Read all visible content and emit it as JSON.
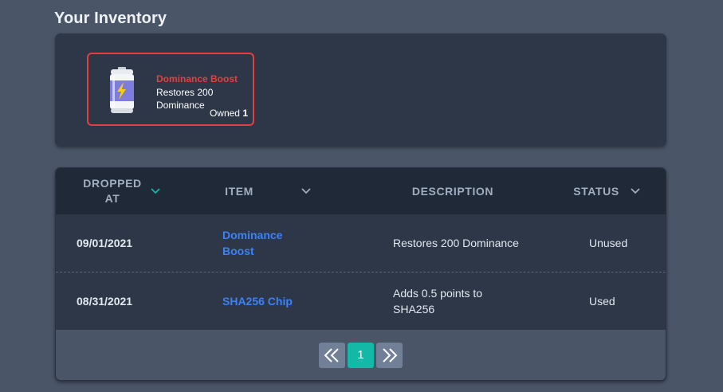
{
  "page": {
    "title": "Your Inventory"
  },
  "inventory": {
    "items": [
      {
        "name": "Dominance Boost",
        "description": "Restores 200 Dominance",
        "owned_label": "Owned",
        "owned_count": "1",
        "icon": "energy-can-icon"
      }
    ]
  },
  "table": {
    "headers": {
      "dropped_at": "DROPPED AT",
      "item": "ITEM",
      "description": "DESCRIPTION",
      "status": "STATUS"
    },
    "rows": [
      {
        "dropped_at": "09/01/2021",
        "item": "Dominance Boost",
        "description": "Restores 200 Dominance",
        "status": "Unused"
      },
      {
        "dropped_at": "08/31/2021",
        "item": "SHA256 Chip",
        "description": "Adds 0.5 points to SHA256",
        "status": "Used"
      }
    ]
  },
  "pagination": {
    "current_page": "1"
  },
  "colors": {
    "background": "#4a5568",
    "panel": "#2d3748",
    "table_header": "#1f2937",
    "highlight_border": "#e53e3e",
    "link": "#3b82f6",
    "active_page": "#14b8a6",
    "sort_active": "#14b8a6"
  }
}
